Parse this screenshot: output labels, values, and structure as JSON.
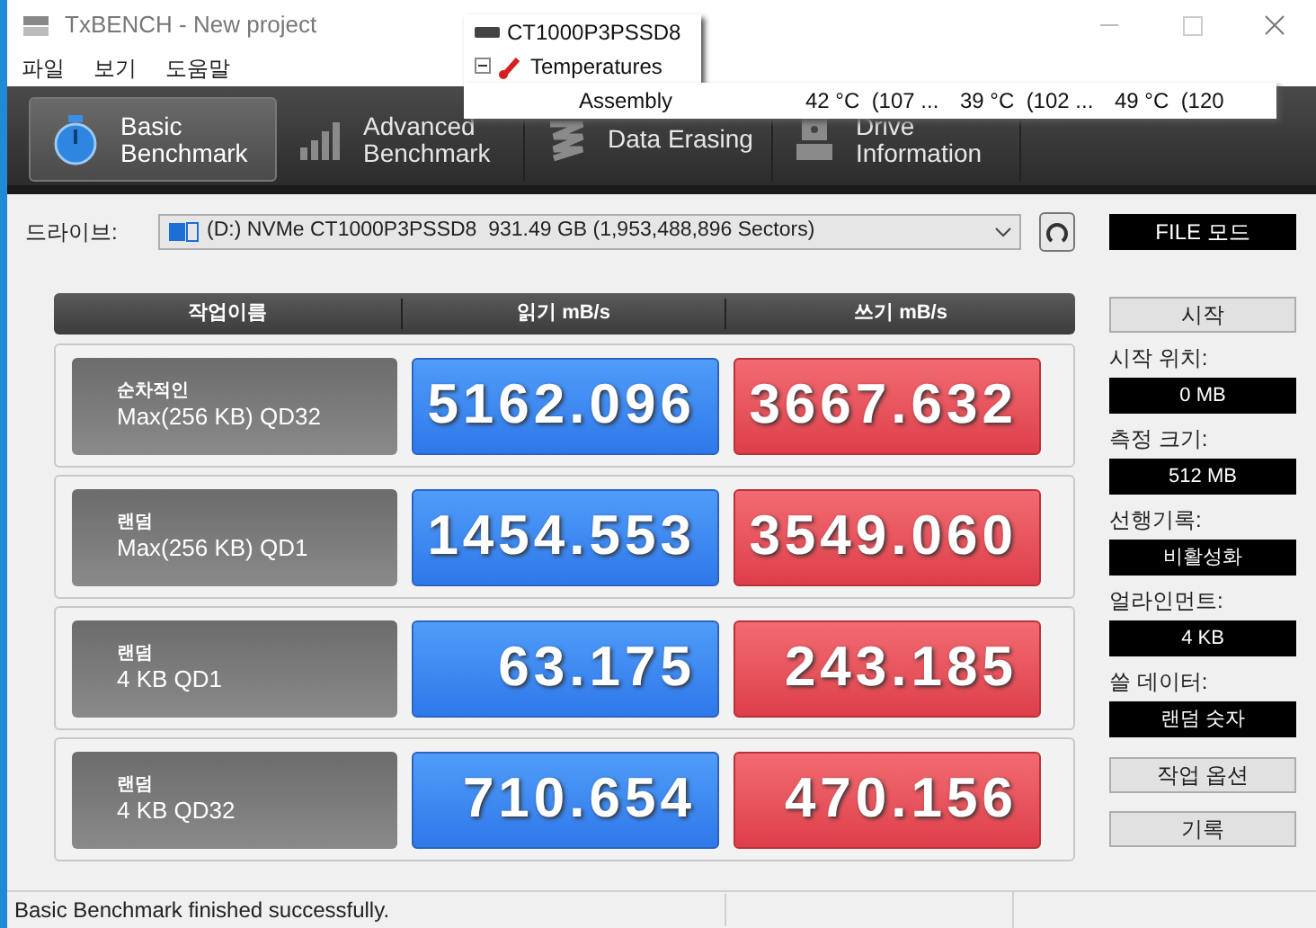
{
  "window": {
    "title": "TxBENCH - New project"
  },
  "menu": [
    "파일",
    "보기",
    "도움말"
  ],
  "tabs": [
    {
      "kind": "timer",
      "lines": [
        "Basic",
        "Benchmark"
      ],
      "selected": true
    },
    {
      "kind": "bars",
      "lines": [
        "Advanced",
        "Benchmark"
      ],
      "selected": false
    },
    {
      "kind": "erase",
      "lines": [
        "Data Erasing"
      ],
      "selected": false
    },
    {
      "kind": "drive",
      "lines": [
        "Drive",
        "Information"
      ],
      "selected": false
    }
  ],
  "drive": {
    "label": "드라이브:",
    "value": "(D:) NVMe CT1000P3PSSD8  931.49 GB (1,953,488,896 Sectors)"
  },
  "mode": "FILE 모드",
  "table": {
    "columns": [
      "작업이름",
      "읽기 mB/s",
      "쓰기 mB/s"
    ],
    "rows": [
      {
        "type": "순차적인",
        "name": "Max(256 KB) QD32",
        "read": "5162.096",
        "write": "3667.632"
      },
      {
        "type": "랜덤",
        "name": "Max(256 KB) QD1",
        "read": "1454.553",
        "write": "3549.060"
      },
      {
        "type": "랜덤",
        "name": "4 KB QD1",
        "read": "63.175",
        "write": "243.185"
      },
      {
        "type": "랜덤",
        "name": "4 KB QD32",
        "read": "710.654",
        "write": "470.156"
      }
    ]
  },
  "start_button": "시작",
  "settings": [
    {
      "label": "시작 위치:",
      "value": "0 MB"
    },
    {
      "label": "측정 크기:",
      "value": "512 MB"
    },
    {
      "label": "선행기록:",
      "value": "비활성화"
    },
    {
      "label": "얼라인먼트:",
      "value": "4 KB"
    },
    {
      "label": "쓸 데이터:",
      "value": "랜덤 숫자"
    }
  ],
  "buttons": [
    "작업 옵션",
    "기록"
  ],
  "status_bar": "Basic Benchmark finished successfully.",
  "tooltip": {
    "device": "CT1000P3PSSD8",
    "group": "Temperatures",
    "expanded": true,
    "sensor": "Assembly",
    "readings": [
      "42 °C  (107 ...",
      "39 °C  (102 ...",
      "49 °C  (120"
    ]
  }
}
